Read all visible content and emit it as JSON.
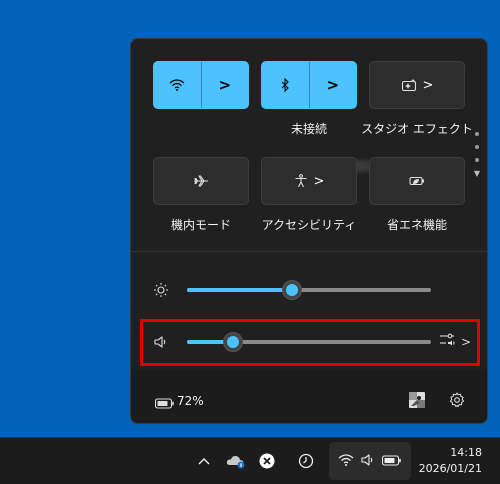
{
  "quick_settings": {
    "tiles": [
      {
        "name": "wifi",
        "label": "",
        "active": true,
        "icon": "wifi-icon",
        "has_chevron": true
      },
      {
        "name": "bluetooth",
        "label": "未接続",
        "active": true,
        "icon": "bluetooth-icon",
        "has_chevron": true
      },
      {
        "name": "studio-effects",
        "label": "スタジオ エフェクト",
        "active": false,
        "icon": "studio-effects-icon",
        "has_chevron": true
      },
      {
        "name": "airplane-mode",
        "label": "機内モード",
        "active": false,
        "icon": "airplane-icon",
        "has_chevron": false
      },
      {
        "name": "accessibility",
        "label": "アクセシビリティ",
        "active": false,
        "icon": "accessibility-icon",
        "has_chevron": true
      },
      {
        "name": "energy-saver",
        "label": "省エネ機能",
        "active": false,
        "icon": "energy-saver-icon",
        "has_chevron": false
      }
    ],
    "chevron_glyph": ">",
    "brightness": {
      "icon": "brightness-icon",
      "value": 0.43
    },
    "volume": {
      "icon": "speaker-icon",
      "value": 0.19,
      "output_icon": "audio-output-icon",
      "chevron_glyph": ">"
    },
    "battery": {
      "icon": "battery-icon",
      "percent_text": "72%"
    },
    "footer_icons": [
      "edit-icon",
      "settings-icon"
    ]
  },
  "taskbar": {
    "tray_icons": [
      "chevron-up-icon",
      "onedrive-icon",
      "close-circle-icon",
      "timer-icon"
    ],
    "system_icons": [
      "wifi-icon",
      "speaker-icon",
      "battery-icon"
    ],
    "time": "14:18",
    "date": "2026/01/21"
  },
  "colors": {
    "accent": "#4cc2ff",
    "desktop": "#0062b8",
    "panel": "#202020",
    "highlight": "#e00000"
  }
}
